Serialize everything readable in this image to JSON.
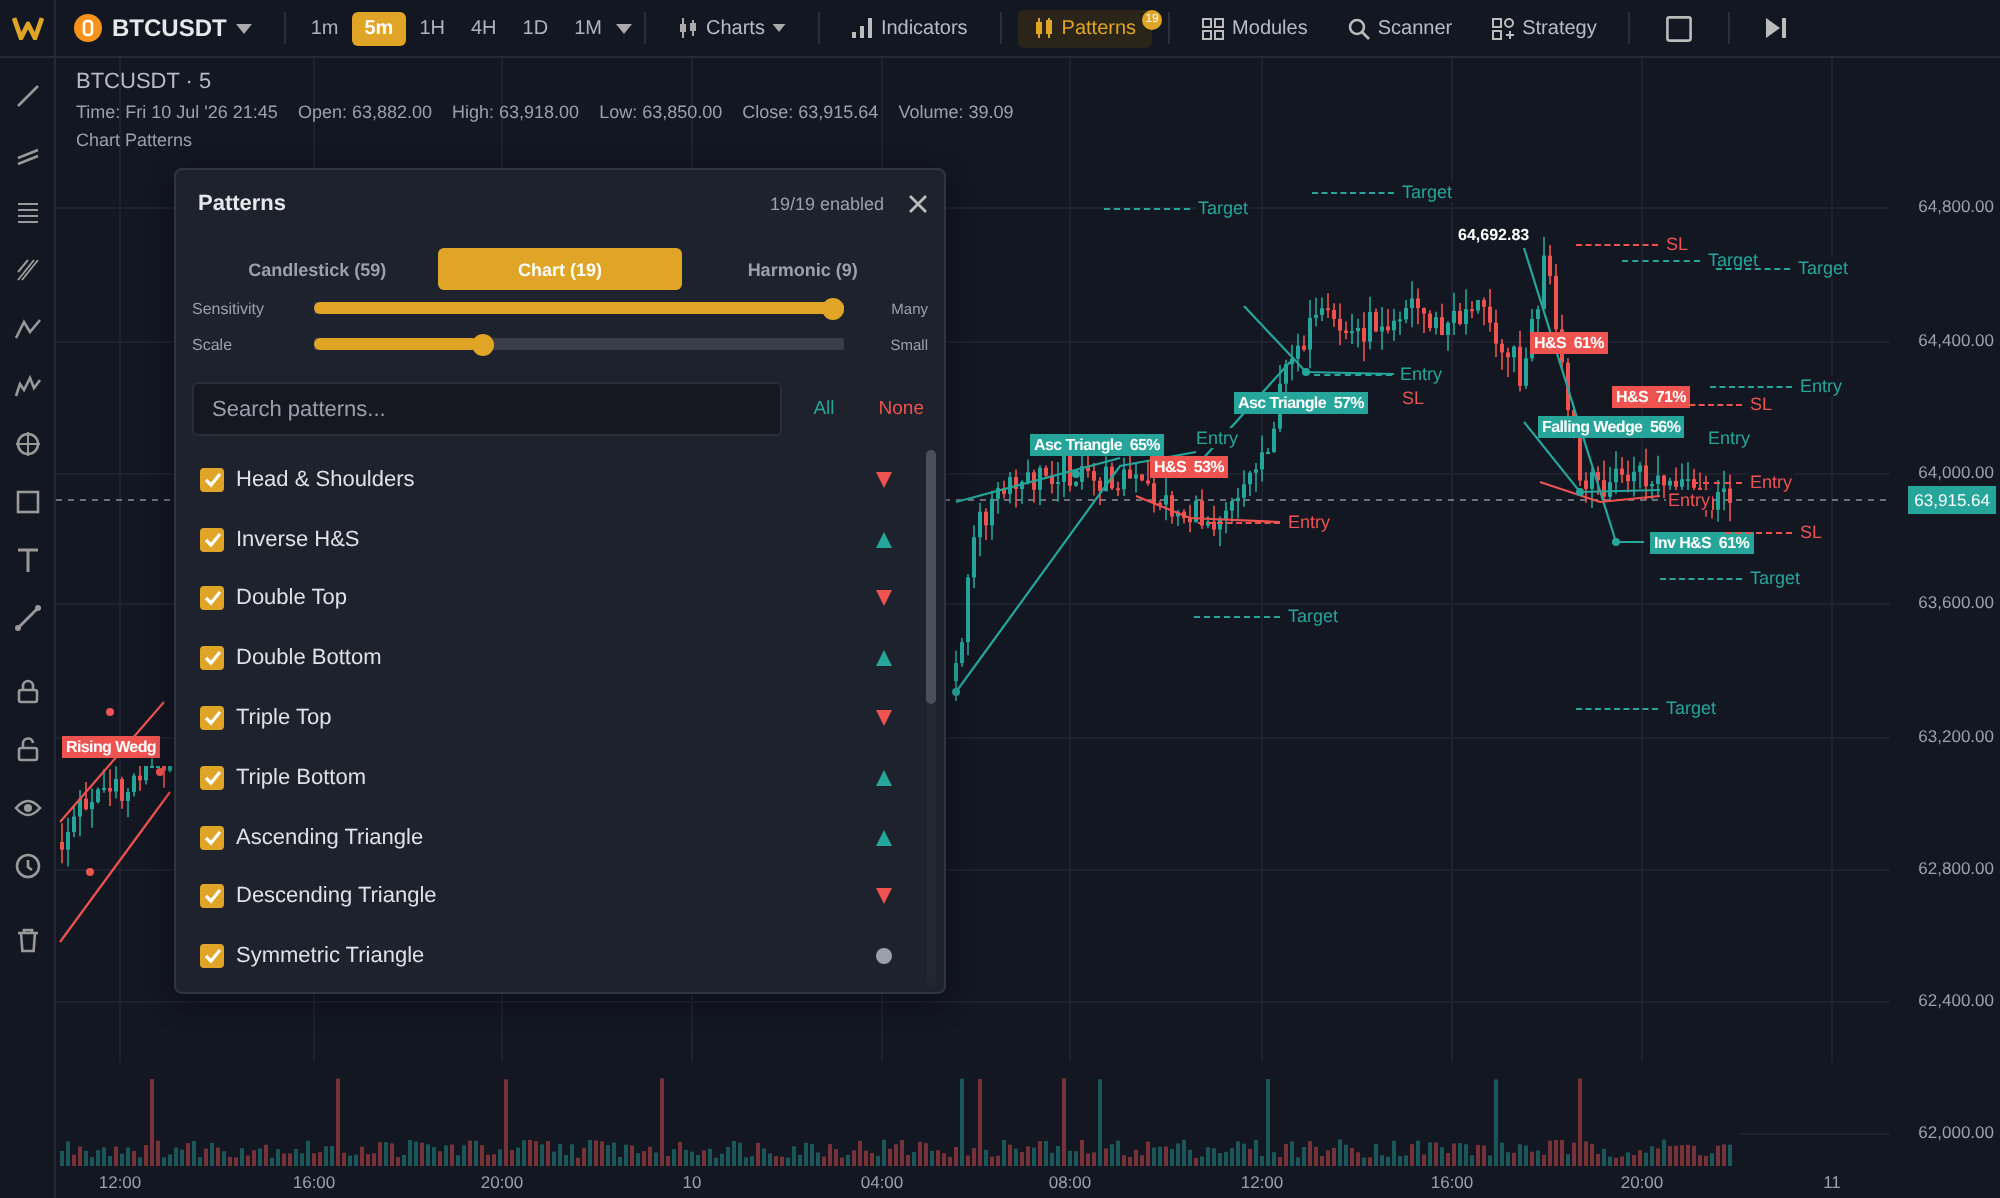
{
  "toolbar": {
    "symbol": "BTCUSDT",
    "timeframes": [
      {
        "label": "1m",
        "selected": false
      },
      {
        "label": "5m",
        "selected": true
      },
      {
        "label": "1H",
        "selected": false
      },
      {
        "label": "4H",
        "selected": false
      },
      {
        "label": "1D",
        "selected": false
      },
      {
        "label": "1M",
        "selected": false
      }
    ],
    "tools": [
      {
        "label": "Charts",
        "kind": "charts",
        "selected": false
      },
      {
        "label": "Indicators",
        "kind": "indicators",
        "selected": false
      },
      {
        "label": "Patterns",
        "kind": "patterns",
        "selected": true,
        "badge": "19"
      },
      {
        "label": "Modules",
        "kind": "modules",
        "selected": false
      },
      {
        "label": "Scanner",
        "kind": "scanner",
        "selected": false
      },
      {
        "label": "Strategy",
        "kind": "strategy",
        "selected": false
      }
    ]
  },
  "legend": {
    "title": "BTCUSDT · 5",
    "fields": [
      "Time: Fri 10 Jul '26 21:45",
      "Open: 63,882.00",
      "High: 63,918.00",
      "Low: 63,850.00",
      "Close: 63,915.64",
      "Volume: 39.09"
    ],
    "subtitle": "Chart Patterns"
  },
  "chart": {
    "last_price": "63,915.64",
    "price_axis": [
      "64,800.00",
      "64,400.00",
      "64,000.00",
      "63,600.00",
      "63,200.00",
      "62,800.00",
      "62,400.00",
      "62,000.00"
    ],
    "time_axis": [
      "12:00",
      "16:00",
      "20:00",
      "10",
      "04:00",
      "08:00",
      "12:00",
      "16:00",
      "20:00",
      "11"
    ],
    "annotations": [
      {
        "text": "Target",
        "kind": "level",
        "color": "#26a69a"
      },
      {
        "text": "Target",
        "kind": "level",
        "color": "#26a69a"
      },
      {
        "text": "64,692.83",
        "kind": "price",
        "color": "#ffffff"
      },
      {
        "text": "SL",
        "kind": "level",
        "color": "#ef5350"
      },
      {
        "text": "Target",
        "kind": "level",
        "color": "#26a69a"
      },
      {
        "text": "Target",
        "kind": "level",
        "color": "#26a69a"
      },
      {
        "text": "H&S  61%",
        "kind": "pattern",
        "color": "#ef5350"
      },
      {
        "text": "Entry",
        "kind": "level",
        "color": "#26a69a"
      },
      {
        "text": "Asc Triangle  57%",
        "kind": "pattern",
        "color": "#26a69a"
      },
      {
        "text": "SL",
        "kind": "level",
        "color": "#ef5350"
      },
      {
        "text": "H&S  71%",
        "kind": "pattern",
        "color": "#ef5350"
      },
      {
        "text": "SL",
        "kind": "level",
        "color": "#ef5350"
      },
      {
        "text": "Entry",
        "kind": "level",
        "color": "#26a69a"
      },
      {
        "text": "Asc Triangle  65%",
        "kind": "pattern",
        "color": "#26a69a"
      },
      {
        "text": "Entry",
        "kind": "level",
        "color": "#26a69a"
      },
      {
        "text": "Falling Wedge  56%",
        "kind": "pattern",
        "color": "#26a69a"
      },
      {
        "text": "Entry",
        "kind": "level",
        "color": "#26a69a"
      },
      {
        "text": "H&S  53%",
        "kind": "pattern",
        "color": "#ef5350"
      },
      {
        "text": "Entry",
        "kind": "level",
        "color": "#ef5350"
      },
      {
        "text": "Entry",
        "kind": "level",
        "color": "#ef5350"
      },
      {
        "text": "Entry",
        "kind": "level",
        "color": "#ef5350"
      },
      {
        "text": "Inv H&S  61%",
        "kind": "pattern",
        "color": "#26a69a"
      },
      {
        "text": "SL",
        "kind": "level",
        "color": "#ef5350"
      },
      {
        "text": "Target",
        "kind": "level",
        "color": "#26a69a"
      },
      {
        "text": "Target",
        "kind": "level",
        "color": "#26a69a"
      },
      {
        "text": "Target",
        "kind": "level",
        "color": "#26a69a"
      },
      {
        "text": "Rising Wedg",
        "kind": "pattern",
        "color": "#ef5350"
      }
    ]
  },
  "panel": {
    "title": "Patterns",
    "status": "19/19 enabled",
    "tabs": [
      {
        "label": "Candlestick (59)",
        "selected": false
      },
      {
        "label": "Chart (19)",
        "selected": true
      },
      {
        "label": "Harmonic (9)",
        "selected": false
      }
    ],
    "sliders": [
      {
        "label": "Sensitivity",
        "level": 1.0,
        "end_label": "Many"
      },
      {
        "label": "Scale",
        "level": 0.31,
        "end_label": "Small"
      }
    ],
    "search": {
      "placeholder": "Search patterns..."
    },
    "select_all": "All",
    "select_none": "None",
    "patterns": [
      {
        "name": "Head & Shoulders",
        "checked": true,
        "kind": "bearish"
      },
      {
        "name": "Inverse H&S",
        "checked": true,
        "kind": "bullish"
      },
      {
        "name": "Double Top",
        "checked": true,
        "kind": "bearish"
      },
      {
        "name": "Double Bottom",
        "checked": true,
        "kind": "bullish"
      },
      {
        "name": "Triple Top",
        "checked": true,
        "kind": "bearish"
      },
      {
        "name": "Triple Bottom",
        "checked": true,
        "kind": "bullish"
      },
      {
        "name": "Ascending Triangle",
        "checked": true,
        "kind": "bullish"
      },
      {
        "name": "Descending Triangle",
        "checked": true,
        "kind": "bearish"
      },
      {
        "name": "Symmetric Triangle",
        "checked": true,
        "kind": "neutral"
      }
    ]
  }
}
